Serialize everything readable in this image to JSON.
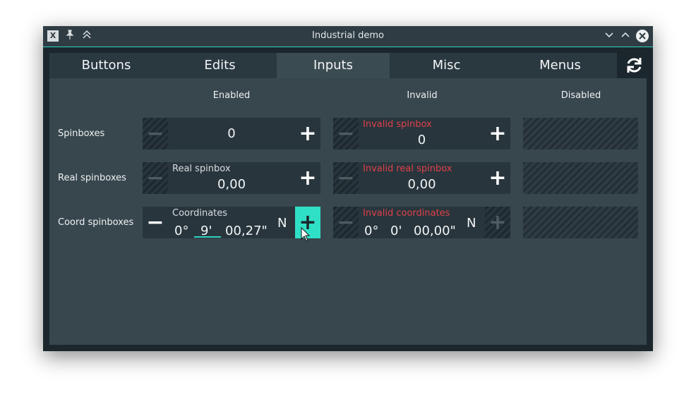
{
  "window": {
    "title": "Industrial demo"
  },
  "titlebar_icons": {
    "app": "X",
    "pin": "📌",
    "shade": "⌃⌃",
    "minimize": "⌄",
    "maximize": "⌃",
    "close": "✕"
  },
  "tabs": [
    "Buttons",
    "Edits",
    "Inputs",
    "Misc",
    "Menus"
  ],
  "active_tab": "Inputs",
  "columns": {
    "enabled": "Enabled",
    "invalid": "Invalid",
    "disabled": "Disabled"
  },
  "rows": {
    "spinboxes": {
      "label": "Spinboxes",
      "enabled_value": "0",
      "invalid_label": "Invalid spinbox",
      "invalid_value": "0"
    },
    "real": {
      "label": "Real spinboxes",
      "enabled_label": "Real spinbox",
      "enabled_value": "0,00",
      "invalid_label": "Invalid real spinbox",
      "invalid_value": "0,00"
    },
    "coord": {
      "label": "Coord spinboxes",
      "enabled_label": "Coordinates",
      "enabled_deg": "0°",
      "enabled_min": "9'",
      "enabled_sec": "00,27\"",
      "enabled_hemi": "N",
      "invalid_label": "Invalid coordinates",
      "invalid_deg": "0°",
      "invalid_min": "0'",
      "invalid_sec": "00,00\"",
      "invalid_hemi": "N"
    }
  },
  "glyphs": {
    "plus": "+",
    "minus": "−"
  },
  "colors": {
    "accent": "#2fd3c0",
    "invalid": "#e0404a",
    "panel": "#38474e",
    "tab_active": "#3b4b52"
  }
}
